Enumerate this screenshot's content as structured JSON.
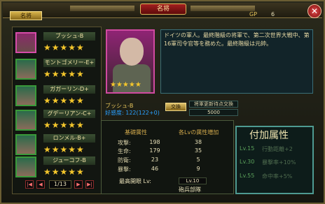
{
  "window": {
    "title": "名将",
    "tab_label": "名将",
    "gp_label": "GP",
    "gp_value": "6",
    "close_glyph": "✕"
  },
  "roster": [
    {
      "name": "ブッシュ-B",
      "stars": "★★★★★"
    },
    {
      "name": "モントゴメリー-E+",
      "stars": "★★★★★"
    },
    {
      "name": "ガガーリン-D+",
      "stars": "★★★★★"
    },
    {
      "name": "グデーリアン-C+",
      "stars": "★★★★★"
    },
    {
      "name": "ロンメル-B+",
      "stars": "★★★★★"
    },
    {
      "name": "ジューコフ-B",
      "stars": "★★★★★"
    }
  ],
  "pager": {
    "first": "|◀",
    "prev": "◀",
    "value": "1/13",
    "next": "▶",
    "last": "▶|"
  },
  "selected": {
    "description": "ドイツの軍人。最終階級の将軍で、第二次世界大戦中、第16軍司令官等を務めた。最終階級は元帥。",
    "portrait_stars": "★★★★★",
    "rank_line": "ブッシュ-B",
    "stat_line": "好感度: 122(122+0)",
    "swap_label": "交換",
    "reward_label": "将軍更新待点交換",
    "reward_value": "5000"
  },
  "stats": {
    "header_base": "基礎属性",
    "header_growth": "各Lvの属性増加",
    "rows": [
      {
        "label": "攻撃:",
        "base": "198",
        "growth": "38"
      },
      {
        "label": "生命:",
        "base": "179",
        "growth": "35"
      },
      {
        "label": "防衛:",
        "base": "23",
        "growth": "5"
      },
      {
        "label": "暴撃:",
        "base": "46",
        "growth": "9"
      }
    ],
    "extra_label": "最高開眼 Lv:",
    "level_value": "Lv.10",
    "army_label": "砲兵部隊"
  },
  "bonus": {
    "title": "付加属性",
    "lines": [
      {
        "level": "Lv.15",
        "text": "行動距離+2"
      },
      {
        "level": "Lv.30",
        "text": "暴撃率+10%"
      },
      {
        "level": "Lv.55",
        "text": "命中率+5%"
      }
    ]
  }
}
